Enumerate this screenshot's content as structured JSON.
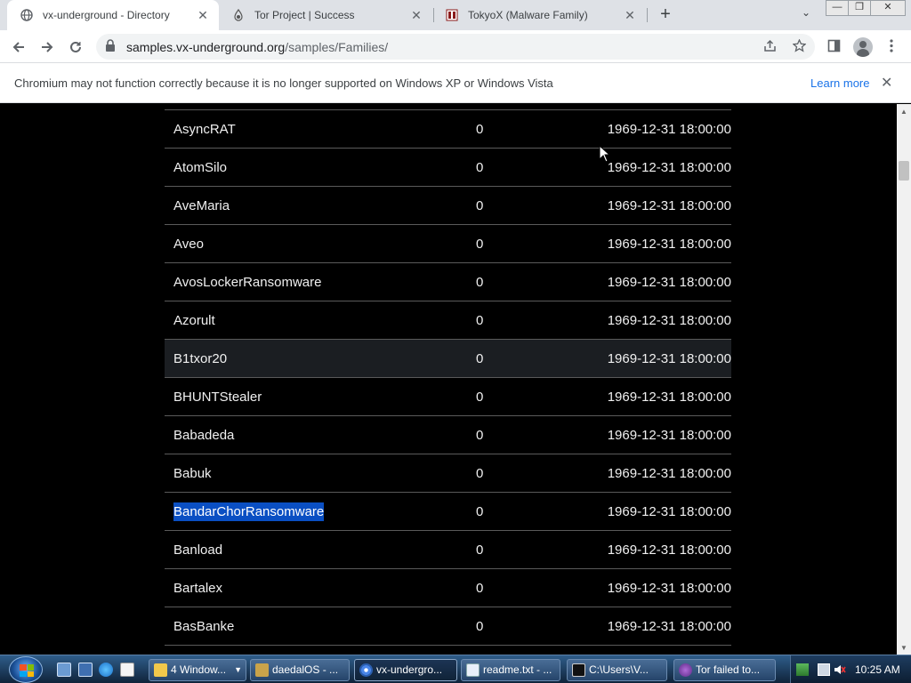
{
  "browser": {
    "tabs": [
      {
        "title": "vx-underground - Directory",
        "favicon": "globe-icon",
        "active": true
      },
      {
        "title": "Tor Project | Success",
        "favicon": "tor-onion-icon",
        "active": false
      },
      {
        "title": "TokyoX (Malware Family)",
        "favicon": "malpedia-icon",
        "active": false
      }
    ],
    "new_tab_symbol": "+",
    "tab_search_symbol": "⌄",
    "window_controls": {
      "minimize": "—",
      "restore": "❐",
      "close": "✕"
    },
    "url_host": "samples.vx-underground.org",
    "url_path": "/samples/Families/",
    "infobar": {
      "message": "Chromium may not function correctly because it is no longer supported on Windows XP or Windows Vista",
      "link": "Learn more"
    }
  },
  "listing": {
    "rows": [
      {
        "name": "AsyncRAT",
        "size": "0",
        "date": "1969-12-31 18:00:00"
      },
      {
        "name": "AtomSilo",
        "size": "0",
        "date": "1969-12-31 18:00:00"
      },
      {
        "name": "AveMaria",
        "size": "0",
        "date": "1969-12-31 18:00:00"
      },
      {
        "name": "Aveo",
        "size": "0",
        "date": "1969-12-31 18:00:00"
      },
      {
        "name": "AvosLockerRansomware",
        "size": "0",
        "date": "1969-12-31 18:00:00"
      },
      {
        "name": "Azorult",
        "size": "0",
        "date": "1969-12-31 18:00:00"
      },
      {
        "name": "B1txor20",
        "size": "0",
        "date": "1969-12-31 18:00:00"
      },
      {
        "name": "BHUNTStealer",
        "size": "0",
        "date": "1969-12-31 18:00:00"
      },
      {
        "name": "Babadeda",
        "size": "0",
        "date": "1969-12-31 18:00:00"
      },
      {
        "name": "Babuk",
        "size": "0",
        "date": "1969-12-31 18:00:00"
      },
      {
        "name": "BandarChorRansomware",
        "size": "0",
        "date": "1969-12-31 18:00:00"
      },
      {
        "name": "Banload",
        "size": "0",
        "date": "1969-12-31 18:00:00"
      },
      {
        "name": "Bartalex",
        "size": "0",
        "date": "1969-12-31 18:00:00"
      },
      {
        "name": "BasBanke",
        "size": "0",
        "date": "1969-12-31 18:00:00"
      }
    ],
    "hovered_row": "B1txor20",
    "selected_text_row": "BandarChorRansomware"
  },
  "taskbar": {
    "tasks": [
      {
        "label": "4 Window...",
        "icon": "folder-icon"
      },
      {
        "label": "daedalOS - ...",
        "icon": "daedalos-icon"
      },
      {
        "label": "vx-undergro...",
        "icon": "chromium-icon"
      },
      {
        "label": "readme.txt - ...",
        "icon": "notepad-icon"
      },
      {
        "label": "C:\\Users\\V...",
        "icon": "cmd-icon"
      },
      {
        "label": "Tor failed to...",
        "icon": "tor-browser-icon"
      }
    ],
    "clock": "10:25 AM"
  },
  "colors": {
    "page_bg": "#000000",
    "row_hover": "#1b1e22",
    "selection": "#0a4fc3",
    "link": "#1a73e8",
    "tabstrip": "#dee1e6"
  }
}
